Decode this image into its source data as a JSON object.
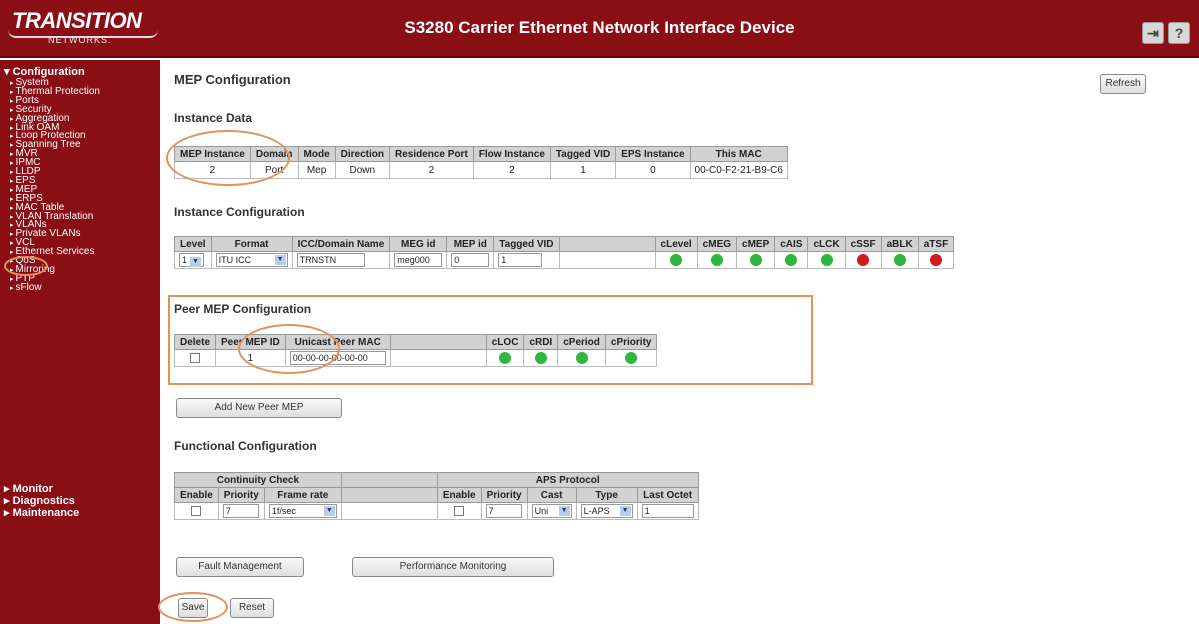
{
  "header": {
    "brand": "TRANSITION",
    "brand_sub": "NETWORKS.",
    "title": "S3280 Carrier Ethernet Network Interface Device",
    "btn_logout_icon": "logout-icon",
    "btn_help_icon": "help-icon",
    "help_glyph": "?",
    "logout_glyph": "⇥"
  },
  "sidebar": {
    "configuration": "Configuration",
    "items": [
      "System",
      "Thermal Protection",
      "Ports",
      "Security",
      "Aggregation",
      "Link OAM",
      "Loop Protection",
      "Spanning Tree",
      "MVR",
      "IPMC",
      "LLDP",
      "EPS",
      "MEP",
      "ERPS",
      "MAC Table",
      "VLAN Translation",
      "VLANs",
      "Private VLANs",
      "VCL",
      "Ethernet Services",
      "QoS",
      "Mirroring",
      "PTP",
      "sFlow"
    ],
    "monitor": "Monitor",
    "diagnostics": "Diagnostics",
    "maintenance": "Maintenance"
  },
  "page": {
    "title": "MEP Configuration",
    "refresh": "Refresh"
  },
  "instance_data": {
    "heading": "Instance Data",
    "headers": [
      "MEP Instance",
      "Domain",
      "Mode",
      "Direction",
      "Residence Port",
      "Flow Instance",
      "Tagged VID",
      "EPS Instance",
      "This MAC"
    ],
    "row": [
      "2",
      "Port",
      "Mep",
      "Down",
      "2",
      "2",
      "1",
      "0",
      "00-C0-F2-21-B9-C6"
    ]
  },
  "instance_config": {
    "heading": "Instance Configuration",
    "headers": [
      "Level",
      "Format",
      "ICC/Domain Name",
      "MEG id",
      "MEP id",
      "Tagged VID",
      "",
      "cLevel",
      "cMEG",
      "cMEP",
      "cAIS",
      "cLCK",
      "cSSF",
      "aBLK",
      "aTSF"
    ],
    "level": "1",
    "format": "ITU ICC",
    "domain_name": "TRNSTN",
    "meg_id": "meg000",
    "mep_id": "0",
    "tagged_vid": "1",
    "leds": [
      "#2db83d",
      "#2db83d",
      "#2db83d",
      "#2db83d",
      "#2db83d",
      "#d11a1a",
      "#2db83d",
      "#d11a1a"
    ]
  },
  "peer_mep": {
    "heading": "Peer MEP Configuration",
    "headers": [
      "Delete",
      "Peer MEP ID",
      "Unicast Peer MAC",
      "",
      "cLOC",
      "cRDI",
      "cPeriod",
      "cPriority"
    ],
    "peer_id": "1",
    "mac": "00-00-00-00-00-00",
    "leds": [
      "#2db83d",
      "#2db83d",
      "#2db83d",
      "#2db83d"
    ],
    "add_button": "Add New Peer MEP"
  },
  "functional": {
    "heading": "Functional Configuration",
    "group_cc": "Continuity Check",
    "group_aps": "APS Protocol",
    "headers": [
      "Enable",
      "Priority",
      "Frame rate",
      "",
      "Enable",
      "Priority",
      "Cast",
      "Type",
      "Last Octet"
    ],
    "cc_priority": "7",
    "frame_rate": "1f/sec",
    "aps_priority": "7",
    "cast": "Uni",
    "type": "L-APS",
    "last_octet": "1"
  },
  "buttons": {
    "fault": "Fault Management",
    "performance": "Performance Monitoring",
    "save": "Save",
    "reset": "Reset"
  },
  "colors": {
    "brand": "#8a0f14",
    "highlight": "#e3915a",
    "led_green": "#2db83d",
    "led_red": "#d11a1a"
  }
}
